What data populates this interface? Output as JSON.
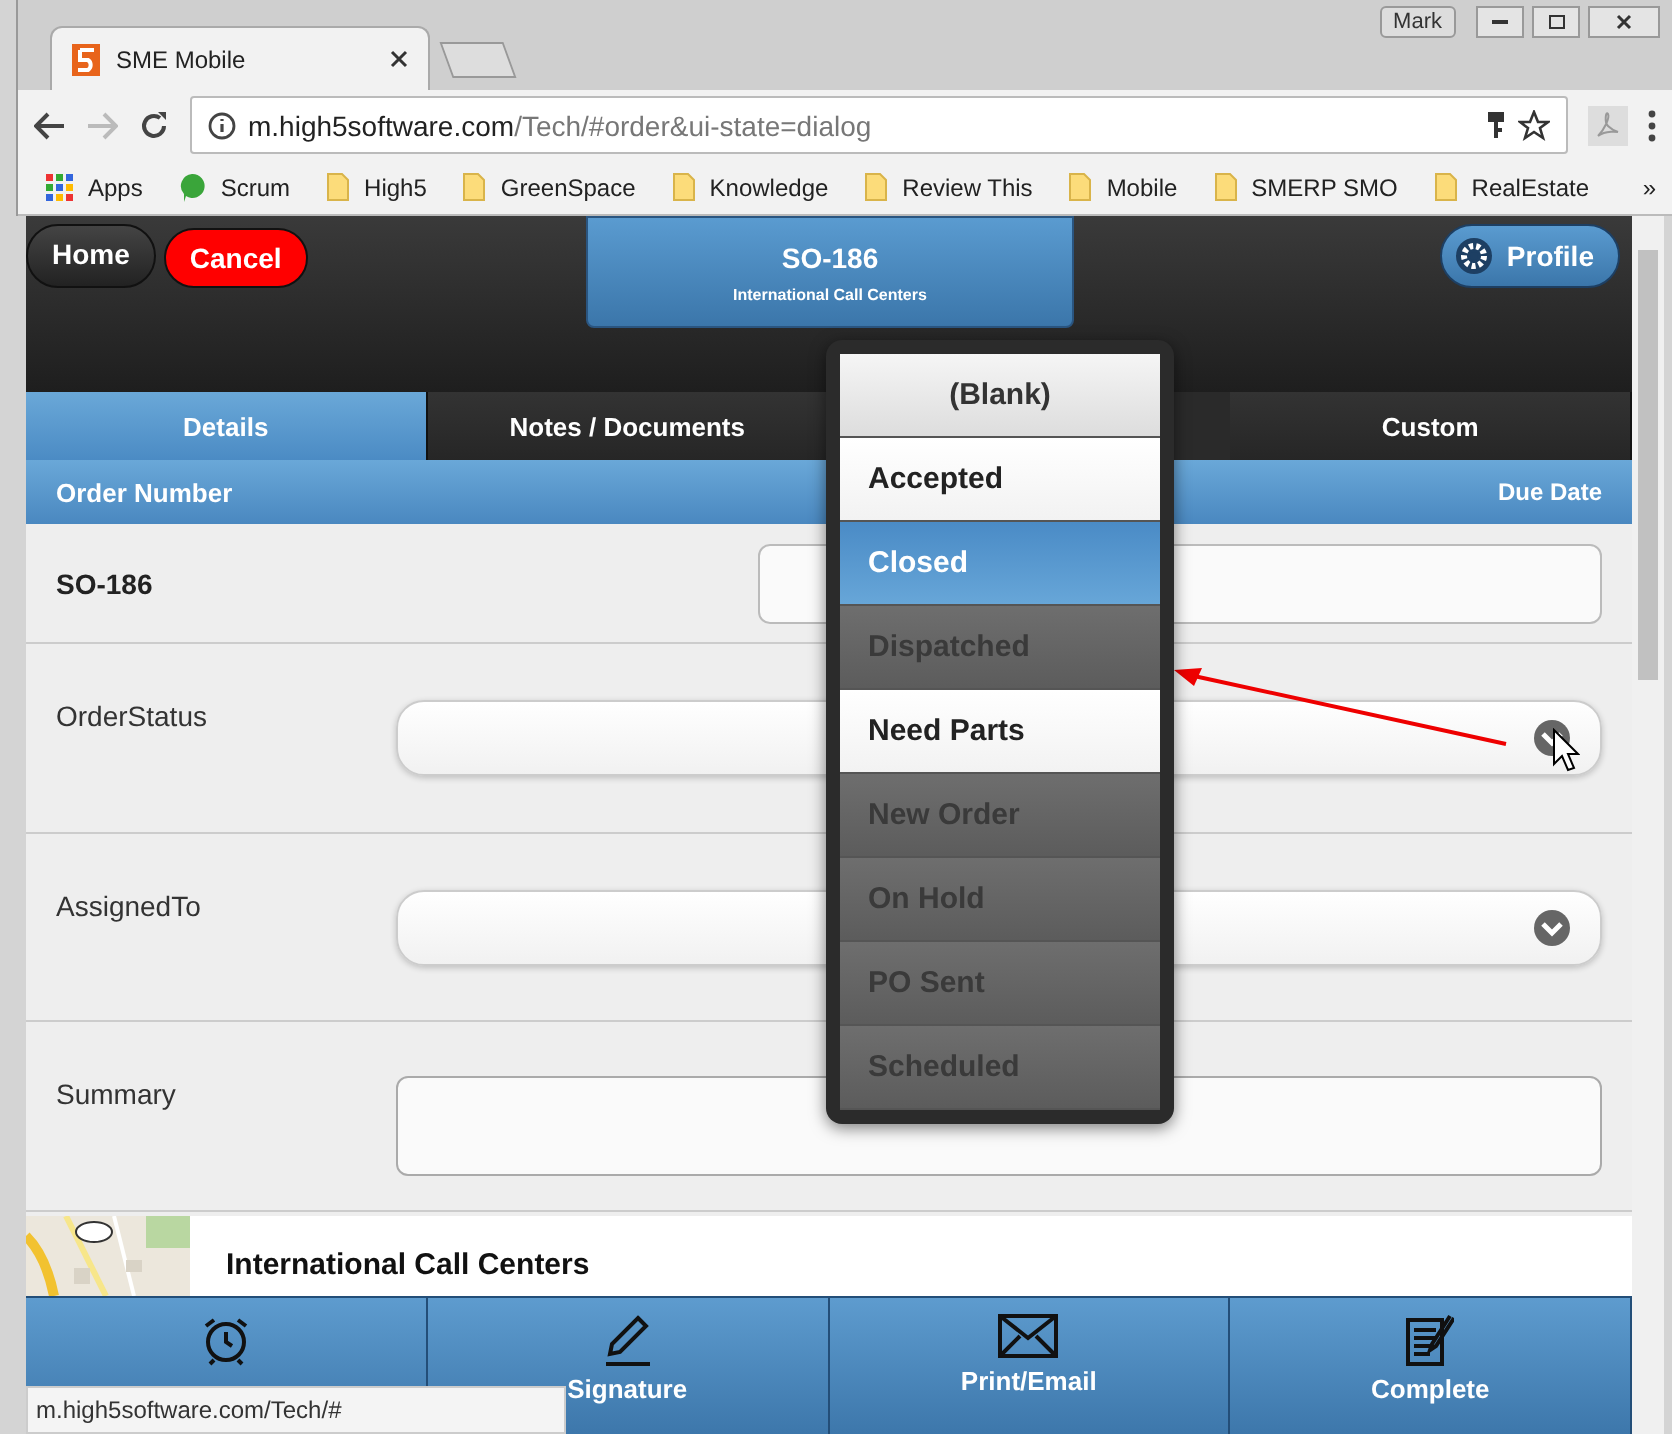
{
  "browser": {
    "user": "Mark",
    "tab_title": "SME Mobile",
    "url_host": "m.high5software.com",
    "url_path": "/Tech/#order&ui-state=dialog",
    "bookmarks": [
      {
        "kind": "apps",
        "label": "Apps"
      },
      {
        "kind": "chat",
        "label": "Scrum"
      },
      {
        "kind": "folder",
        "label": "High5"
      },
      {
        "kind": "folder",
        "label": "GreenSpace"
      },
      {
        "kind": "folder",
        "label": "Knowledge"
      },
      {
        "kind": "folder",
        "label": "Review This"
      },
      {
        "kind": "folder",
        "label": "Mobile"
      },
      {
        "kind": "folder",
        "label": "SMERP SMO"
      },
      {
        "kind": "folder",
        "label": "RealEstate"
      }
    ],
    "overflow": "»"
  },
  "header": {
    "home": "Home",
    "cancel": "Cancel",
    "title": "SO-186",
    "subtitle": "International Call Centers",
    "profile": "Profile"
  },
  "tabs": [
    {
      "label": "Details",
      "selected": true
    },
    {
      "label": "Notes / Documents",
      "selected": false
    },
    {
      "label": "Custom",
      "selected": false
    }
  ],
  "section": {
    "left": "Order Number",
    "right": "Due Date"
  },
  "order_number": "SO-186",
  "fields": [
    {
      "kind": "select",
      "label": "OrderStatus"
    },
    {
      "kind": "select",
      "label": "AssignedTo"
    },
    {
      "kind": "textarea",
      "label": "Summary"
    }
  ],
  "location": {
    "title": "International Call Centers"
  },
  "footer": [
    {
      "kind": "clock"
    },
    {
      "kind": "pen",
      "label": "Signature"
    },
    {
      "kind": "mail",
      "label": "Print/Email"
    },
    {
      "kind": "form",
      "label": "Complete"
    }
  ],
  "dropdown": {
    "options": [
      {
        "kind": "placeholder",
        "label": "(Blank)"
      },
      {
        "kind": "option",
        "label": "Accepted",
        "selected": false,
        "disabled": false
      },
      {
        "kind": "option",
        "label": "Closed",
        "selected": true,
        "disabled": false
      },
      {
        "kind": "option",
        "label": "Dispatched",
        "selected": false,
        "disabled": true
      },
      {
        "kind": "option",
        "label": "Need Parts",
        "selected": false,
        "disabled": false
      },
      {
        "kind": "option",
        "label": "New Order",
        "selected": false,
        "disabled": true
      },
      {
        "kind": "option",
        "label": "On Hold",
        "selected": false,
        "disabled": true
      },
      {
        "kind": "option",
        "label": "PO Sent",
        "selected": false,
        "disabled": true
      },
      {
        "kind": "option",
        "label": "Scheduled",
        "selected": false,
        "disabled": true
      }
    ]
  },
  "status_bar": "m.high5software.com/Tech/#"
}
